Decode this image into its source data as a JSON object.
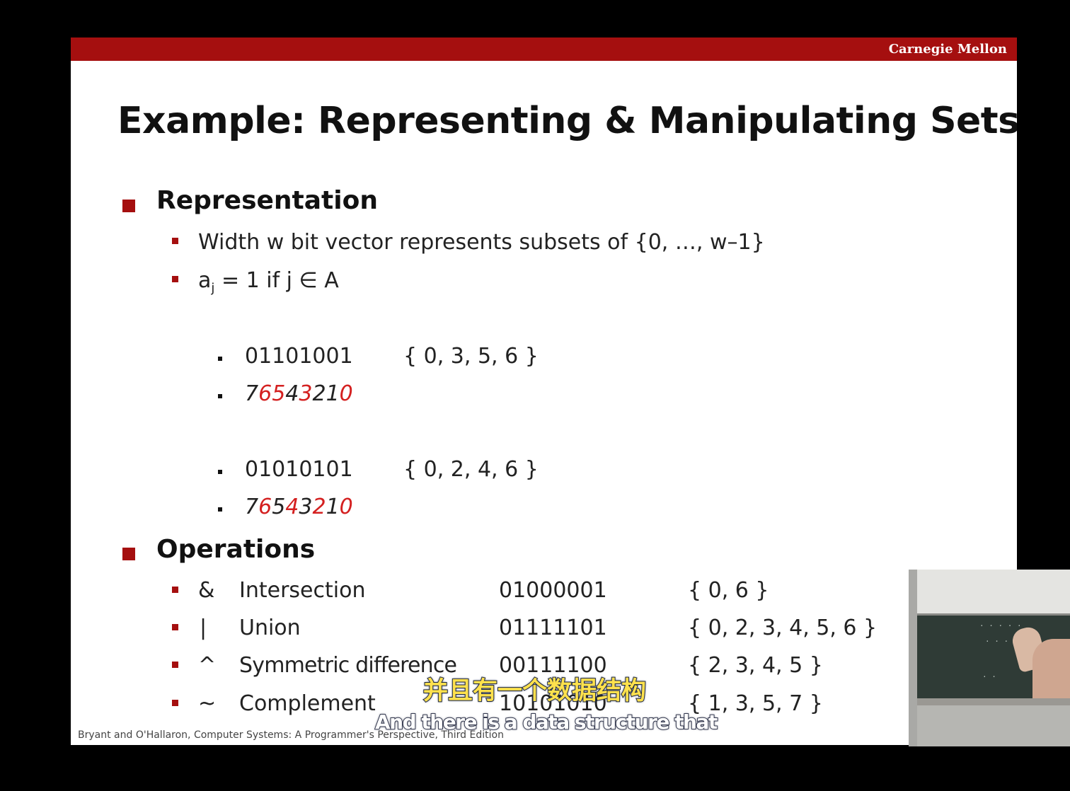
{
  "header": {
    "brand": "Carnegie Mellon"
  },
  "title": "Example: Representing & Manipulating Sets",
  "representation": {
    "heading": "Representation",
    "bullet1": "Width w bit vector represents subsets of {0, …, w–1}",
    "bullet2": {
      "a": "a",
      "sub": "j",
      "rest": " = 1 if j  ∈ A"
    },
    "examples": [
      {
        "bits": "01101001",
        "set": "{ 0, 3, 5, 6 }",
        "index_digits": [
          {
            "d": "7",
            "red": false
          },
          {
            "d": "6",
            "red": true
          },
          {
            "d": "5",
            "red": true
          },
          {
            "d": "4",
            "red": false
          },
          {
            "d": "3",
            "red": true
          },
          {
            "d": "2",
            "red": false
          },
          {
            "d": "1",
            "red": false
          },
          {
            "d": "0",
            "red": true
          }
        ]
      },
      {
        "bits": "01010101",
        "set": "{ 0, 2, 4, 6 }",
        "index_digits": [
          {
            "d": "7",
            "red": false
          },
          {
            "d": "6",
            "red": true
          },
          {
            "d": "5",
            "red": false
          },
          {
            "d": "4",
            "red": true
          },
          {
            "d": "3",
            "red": false
          },
          {
            "d": "2",
            "red": true
          },
          {
            "d": "1",
            "red": false
          },
          {
            "d": "0",
            "red": true
          }
        ]
      }
    ]
  },
  "operations": {
    "heading": "Operations",
    "rows": [
      {
        "sym": "&",
        "name": "Intersection",
        "bits": "01000001",
        "set": "{ 0, 6 }"
      },
      {
        "sym": "|",
        "name": "Union",
        "bits": "01111101",
        "set": "{ 0, 2, 3, 4, 5, 6 }"
      },
      {
        "sym": "^",
        "name": "Symmetric difference",
        "bits": "00111100",
        "set": "{ 2, 3, 4, 5 }"
      },
      {
        "sym": "~",
        "name": "Complement",
        "bits": "10101010",
        "set": "{ 1, 3, 5, 7 }"
      }
    ]
  },
  "footer": "Bryant and O'Hallaron, Computer Systems: A Programmer's Perspective, Third Edition",
  "subtitles": {
    "chinese": "并且有一个数据结构",
    "english": "And there is a data structure that"
  },
  "colors": {
    "accent": "#a50f0f",
    "highlight": "#d42020"
  }
}
